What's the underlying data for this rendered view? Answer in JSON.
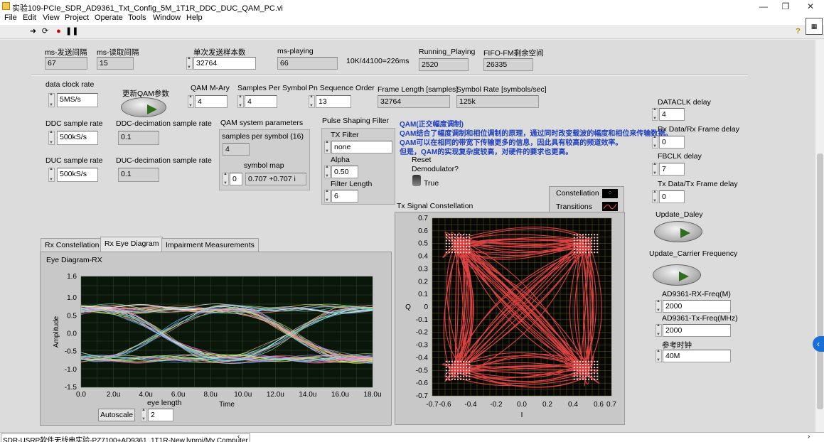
{
  "window": {
    "title": "实验109-PCIe_SDR_AD9361_Txt_Config_5M_1T1R_DDC_DUC_QAM_PC.vi",
    "minimize": "—",
    "restore": "❐",
    "close": "✕"
  },
  "menu": [
    "File",
    "Edit",
    "View",
    "Project",
    "Operate",
    "Tools",
    "Window",
    "Help"
  ],
  "toolbar_icons": [
    "run-arrow-icon",
    "run-continuously-icon",
    "abort-icon",
    "pause-icon"
  ],
  "top_row": {
    "send_interval": {
      "label": "ms-发送间隔",
      "value": "67"
    },
    "read_interval": {
      "label": "ms-读取间隔",
      "value": "15"
    },
    "samples_per_send": {
      "label": "单次发送样本数",
      "value": "32764"
    },
    "ms_playing": {
      "label": "ms-playing",
      "value": "66"
    },
    "note": "10K/44100=226ms",
    "running_playing": {
      "label": "Running_Playing",
      "value": "2520"
    },
    "fifo_remaining": {
      "label": "FIFO-FM剩余空间",
      "value": "26335"
    }
  },
  "config": {
    "data_clock_rate": {
      "label": "data clock rate",
      "value": "5MS/s"
    },
    "update_qam": {
      "label": "更新QAM参数"
    },
    "ddc_sample_rate": {
      "label": "DDC sample rate",
      "value": "500kS/s"
    },
    "ddc_decimation": {
      "label": "DDC-decimation sample rate",
      "value": "0.1"
    },
    "duc_sample_rate": {
      "label": "DUC sample rate",
      "value": "500kS/s"
    },
    "duc_decimation": {
      "label": "DUC-decimation sample rate",
      "value": "0.1"
    },
    "qam_m_ary": {
      "label": "QAM M-Ary",
      "value": "4"
    },
    "samples_per_symbol": {
      "label": "Samples Per Symbol",
      "value": "4"
    },
    "pn_sequence_order": {
      "label": "Pn Sequence Order",
      "value": "13"
    },
    "frame_length": {
      "label": "Frame Length [samples]",
      "value": "32764"
    },
    "symbol_rate": {
      "label": "Symbol Rate [symbols/sec]",
      "value": "125k"
    },
    "qam_system_params": {
      "label": "QAM system parameters",
      "sps_label": "samples per symbol (16)",
      "sps_value": "4",
      "symbol_map_label": "symbol map",
      "symbol_map_index": "0",
      "symbol_map_value": "0.707 +0.707 i"
    },
    "pulse_shaping": {
      "label": "Pulse Shaping Filter",
      "tx_filter_label": "TX Filter",
      "tx_filter_value": "none",
      "alpha_label": "Alpha",
      "alpha_value": "0.50",
      "filter_length_label": "Filter Length",
      "filter_length_value": "6"
    },
    "qam_desc": {
      "title": "QAM(正交幅度调制)",
      "line1": "QAM结合了幅度调制和相位调制的原理，通过同时改变载波的幅度和相位来传输数据。",
      "line2": "QAM可以在相同的带宽下传输更多的信息，因此具有较高的频道效率。",
      "line3": "但是，QAM的实现复杂度较高，对硬件的要求也更高。"
    },
    "reset_demod": {
      "label1": "Reset",
      "label2": "Demodulator?",
      "value": "True"
    }
  },
  "right": {
    "dataclk_delay": {
      "label": "DATACLK delay",
      "value": "4"
    },
    "rx_frame_delay": {
      "label": "Rx Data/Rx Frame delay",
      "value": "0"
    },
    "fbclk_delay": {
      "label": "FBCLK delay",
      "value": "7"
    },
    "tx_frame_delay": {
      "label": "Tx Data/Tx Frame delay",
      "value": "0"
    },
    "update_delay": {
      "label": "Update_Daley"
    },
    "update_carrier": {
      "label": "Update_Carrier Frequency"
    },
    "rx_freq": {
      "label": "AD9361-RX-Freq(M)",
      "value": "2000"
    },
    "tx_freq": {
      "label": "AD9361-Tx-Freq(MHz)",
      "value": "2000"
    },
    "ref_clock": {
      "label": "参考时钟",
      "value": "40M"
    }
  },
  "tabs": [
    "Rx Constellation",
    "Rx Eye Diagram",
    "Impairment Measurements"
  ],
  "active_tab": 1,
  "eye_diagram": {
    "title": "Eye Diagram-RX",
    "ylabel": "Amplitude",
    "xlabel": "Time",
    "yticks": [
      "1.6",
      "1.0",
      "0.5",
      "0.0",
      "-0.5",
      "-1.0",
      "-1.5"
    ],
    "xticks": [
      "0.0",
      "2.0u",
      "4.0u",
      "6.0u",
      "8.0u",
      "10.0u",
      "12.0u",
      "14.0u",
      "16.0u",
      "18.0u"
    ],
    "autoscale_label": "Autoscale",
    "eye_length_label": "eye length",
    "eye_length_value": "2"
  },
  "tx_constellation": {
    "title": "Tx Signal Constellation",
    "legend": [
      "Constellation",
      "Transitions"
    ],
    "ylabel": "Q",
    "xlabel": "I",
    "ticks": [
      "-0.7",
      "-0.6",
      "-0.4",
      "-0.2",
      "0.0",
      "0.2",
      "0.4",
      "0.6",
      "0.7"
    ],
    "yticks": [
      "0.7",
      "0.6",
      "0.5",
      "0.4",
      "0.3",
      "0.2",
      "0.1",
      "0",
      "-0.1",
      "-0.2",
      "-0.3",
      "-0.4",
      "-0.5",
      "-0.6",
      "-0.7"
    ],
    "color": "#ff4a4a"
  },
  "status": {
    "path": "SDR-USRP软件无线电实验-PZ7100+AD9361_1T1R-New.lvproj/My Computer"
  }
}
